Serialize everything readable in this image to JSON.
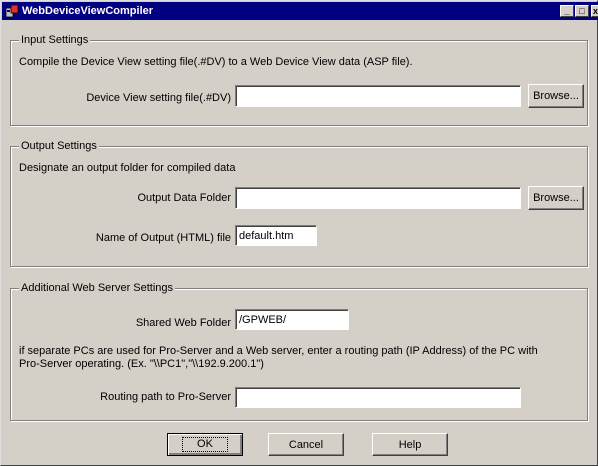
{
  "window": {
    "title": "WebDeviceViewCompiler",
    "minimize_glyph": "_",
    "maximize_glyph": "□",
    "close_glyph": "x"
  },
  "input_settings": {
    "group_label": "Input Settings",
    "description": "Compile the Device View setting file(.#DV) to a Web Device View data (ASP file).",
    "file_label": "Device View setting file(.#DV)",
    "file_value": "",
    "browse_label": "Browse..."
  },
  "output_settings": {
    "group_label": "Output Settings",
    "description": "Designate an output folder for compiled data",
    "folder_label": "Output Data Folder",
    "folder_value": "",
    "browse_label": "Browse...",
    "name_label": "Name of Output (HTML) file",
    "name_value": "default.htm"
  },
  "web_server_settings": {
    "group_label": "Additional Web Server Settings",
    "shared_label": "Shared Web Folder",
    "shared_value": "/GPWEB/",
    "note_line1": "if separate PCs are used for Pro-Server and a Web server, enter a routing path (IP Address) of the PC with",
    "note_line2": "Pro-Server operating. (Ex. \"\\\\PC1\",\"\\\\192.9.200.1\")",
    "routing_label": "Routing path to Pro-Server",
    "routing_value": ""
  },
  "buttons": {
    "ok": "OK",
    "cancel": "Cancel",
    "help": "Help"
  },
  "colors": {
    "dialog_face": "#d4d0c8",
    "title_bar": "#000080"
  }
}
